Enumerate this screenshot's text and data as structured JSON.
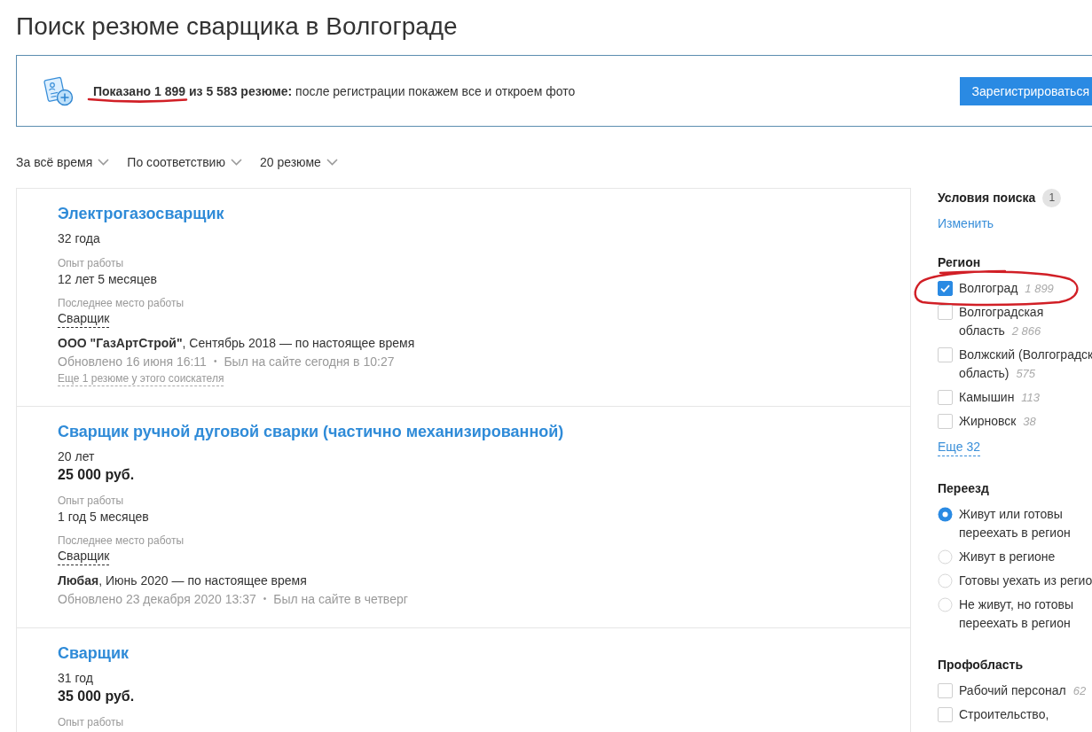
{
  "page_title": "Поиск резюме сварщика в Волгограде",
  "banner": {
    "text": "**Показано 1 899 из 5 583 резюме:** после регистрации покажем все и откроем фото",
    "hand_underlined": true,
    "button": "Зарегистрироваться"
  },
  "sort_options": [
    {
      "label": "За всё время"
    },
    {
      "label": "По соответствию"
    },
    {
      "label": "20 резюме"
    }
  ],
  "resumes": [
    {
      "title": "Электрогазосварщик",
      "age": "32 года",
      "experience_label": "Опыт работы",
      "experience": "12 лет 5 месяцев",
      "last_job_label": "Последнее место работы",
      "last_position": "Сварщик",
      "employer": "**ООО \"ГазАртСтрой\"**, Сентябрь 2018 — по настоящее время",
      "updated": "Обновлено 16 июня 16:11",
      "separator": "•",
      "last_seen": "Был на сайте сегодня в 10:27",
      "more_link": "Еще 1 резюме у этого соискателя"
    },
    {
      "title": "Сварщик ручной дуговой сварки (частично механизированной)",
      "age": "20 лет",
      "salary": "25 000 руб.",
      "experience_label": "Опыт работы",
      "experience": "1 год 5 месяцев",
      "last_job_label": "Последнее место работы",
      "last_position": "Сварщик",
      "employer": "**Любая**, Июнь 2020 — по настоящее время",
      "updated": "Обновлено 23 декабря 2020 13:37",
      "separator": "•",
      "last_seen": "Был на сайте в четверг"
    },
    {
      "title": "Сварщик",
      "age": "31 год",
      "salary": "35 000 руб.",
      "experience_label": "Опыт работы"
    }
  ],
  "sidebar": {
    "conditions": {
      "title": "Условия поиска",
      "count": "1",
      "link": "Изменить"
    },
    "filters": [
      {
        "title": "Регион",
        "kind": "checkbox",
        "options": [
          {
            "lines": [
              "Волгоград"
            ],
            "count": "1 899",
            "checked": true,
            "hand_circled": true
          },
          {
            "lines": [
              "Волгоградская",
              "область"
            ],
            "count": "2 866",
            "checked": false,
            "hand_circled": false
          },
          {
            "lines": [
              "Волжский (Волгоградск",
              "область)"
            ],
            "count": "575",
            "checked": false,
            "hand_circled": false
          },
          {
            "lines": [
              "Камышин"
            ],
            "count": "113",
            "checked": false,
            "hand_circled": false
          },
          {
            "lines": [
              "Жирновск"
            ],
            "count": "38",
            "checked": false,
            "hand_circled": false
          }
        ],
        "more": "Еще 32"
      },
      {
        "title": "Переезд",
        "kind": "radio",
        "options": [
          {
            "lines": [
              "Живут или готовы",
              "переехать в регион"
            ],
            "selected": true
          },
          {
            "lines": [
              "Живут в регионе"
            ],
            "selected": false
          },
          {
            "lines": [
              "Готовы уехать из регио"
            ],
            "selected": false
          },
          {
            "lines": [
              "Не живут, но готовы",
              "переехать в регион"
            ],
            "selected": false
          }
        ]
      },
      {
        "title": "Профобласть",
        "kind": "checkbox",
        "options": [
          {
            "lines": [
              "Рабочий персонал"
            ],
            "count": "62",
            "checked": false
          },
          {
            "lines": [
              "Строительство,"
            ],
            "checked": false
          }
        ]
      }
    ]
  }
}
